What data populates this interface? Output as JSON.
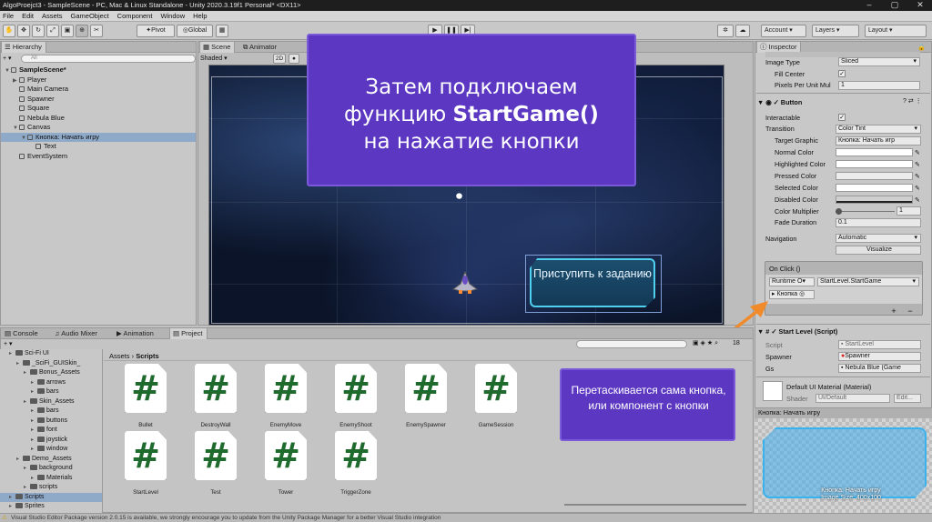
{
  "window": {
    "title": "AlgoProejct3 - SampleScene - PC, Mac & Linux Standalone - Unity 2020.3.19f1 Personal* <DX11>"
  },
  "menu": [
    "File",
    "Edit",
    "Assets",
    "GameObject",
    "Component",
    "Window",
    "Help"
  ],
  "toolbar": {
    "pivot": "Pivot",
    "global": "Global",
    "account": "Account",
    "layers": "Layers",
    "layout": "Layout"
  },
  "hierarchy": {
    "tab": "Hierarchy",
    "search": "All",
    "items": [
      {
        "label": "SampleScene*",
        "indent": 0,
        "fold": "▼",
        "selected": false
      },
      {
        "label": "Player",
        "indent": 1,
        "fold": "▶",
        "selected": false
      },
      {
        "label": "Main Camera",
        "indent": 1,
        "fold": "",
        "selected": false
      },
      {
        "label": "Spawner",
        "indent": 1,
        "fold": "",
        "selected": false
      },
      {
        "label": "Square",
        "indent": 1,
        "fold": "",
        "selected": false
      },
      {
        "label": "Nebula Blue",
        "indent": 1,
        "fold": "",
        "selected": false
      },
      {
        "label": "Canvas",
        "indent": 1,
        "fold": "▼",
        "selected": false
      },
      {
        "label": "Кнопка: Начать игру",
        "indent": 2,
        "fold": "▼",
        "selected": true
      },
      {
        "label": "Text",
        "indent": 3,
        "fold": "",
        "selected": false
      },
      {
        "label": "EventSystem",
        "indent": 1,
        "fold": "",
        "selected": false
      }
    ]
  },
  "scene": {
    "tabs": [
      "Scene",
      "Animator"
    ],
    "shading": "Shaded",
    "mode2d": "2D",
    "button_text": "Приступить к заданию"
  },
  "callout_top": {
    "line1": "Затем подключаем",
    "line2a": "функцию ",
    "line2b": "StartGame()",
    "line3": "на нажатие кнопки"
  },
  "callout_bottom": {
    "text": "Перетаскивается сама кнопка, или компонент с кнопки"
  },
  "inspector": {
    "tab": "Inspector",
    "image_type_label": "Image Type",
    "image_type": "Sliced",
    "fill_center": "Fill Center",
    "ppu_label": "Pixels Per Unit Mul",
    "ppu": "1",
    "button_header": "Button",
    "interactable": "Interactable",
    "transition_label": "Transition",
    "transition": "Color Tint",
    "target_label": "Target Graphic",
    "target": "Кнопка: Начать игр",
    "normal": "Normal Color",
    "highlighted": "Highlighted Color",
    "pressed": "Pressed Color",
    "selected": "Selected Color",
    "disabled": "Disabled Color",
    "multiplier_label": "Color Multiplier",
    "multiplier": "1",
    "fade_label": "Fade Duration",
    "fade": "0.1",
    "navigation_label": "Navigation",
    "navigation": "Automatic",
    "visualize": "Visualize",
    "onclick": "On Click ()",
    "runtime": "Runtime O▾",
    "function": "StartLevel.StartGame",
    "obj": "Кнопка",
    "plus": "+",
    "minus": "−",
    "startlevel_header": "Start Level (Script)",
    "script_label": "Script",
    "script_val": "StartLevel",
    "spawner_label": "Spawner",
    "spawner_val": "Spawner",
    "gs_label": "Gs",
    "gs_val": "Nebula Blue (Game",
    "material_name": "Default UI Material (Material)",
    "shader_label": "Shader",
    "shader_val": "UI/Default",
    "edit": "Edit...",
    "preview_title": "Кнопка: Начать игру",
    "preview_caption1": "Кнопка: Начать игру",
    "preview_caption2": "Image Size: 400x100"
  },
  "bottom": {
    "tabs": [
      "Console",
      "Audio Mixer",
      "Animation",
      "Project"
    ],
    "breadcrumb_root": "Assets",
    "breadcrumb_leaf": "Scripts",
    "count": "18"
  },
  "project_tree": [
    {
      "label": "Sci-Fi UI",
      "indent": 1
    },
    {
      "label": "_SciFi_GUISkin_",
      "indent": 2
    },
    {
      "label": "Bonus_Assets",
      "indent": 3
    },
    {
      "label": "arrows",
      "indent": 4
    },
    {
      "label": "bars",
      "indent": 4
    },
    {
      "label": "Skin_Assets",
      "indent": 3
    },
    {
      "label": "bars",
      "indent": 4
    },
    {
      "label": "buttons",
      "indent": 4
    },
    {
      "label": "font",
      "indent": 4
    },
    {
      "label": "joystick",
      "indent": 4
    },
    {
      "label": "window",
      "indent": 4
    },
    {
      "label": "Demo_Assets",
      "indent": 2
    },
    {
      "label": "background",
      "indent": 3
    },
    {
      "label": "Materials",
      "indent": 4
    },
    {
      "label": "scripts",
      "indent": 3
    },
    {
      "label": "Scripts",
      "indent": 1,
      "selected": true
    },
    {
      "label": "Sprites",
      "indent": 1
    }
  ],
  "assets": [
    {
      "name": "Bullet"
    },
    {
      "name": "DestroyWall"
    },
    {
      "name": "EnemyMove"
    },
    {
      "name": "EnemyShoot"
    },
    {
      "name": "EnemySpawner"
    },
    {
      "name": "GameSession"
    },
    {
      "name": "StartLevel"
    },
    {
      "name": "Test"
    },
    {
      "name": "Tower"
    },
    {
      "name": "TriggerZone"
    }
  ],
  "status": "Visual Studio Editor Package version 2.0.15 is available, we strongly encourage you to update from the Unity Package Manager for a better Visual Studio integration"
}
